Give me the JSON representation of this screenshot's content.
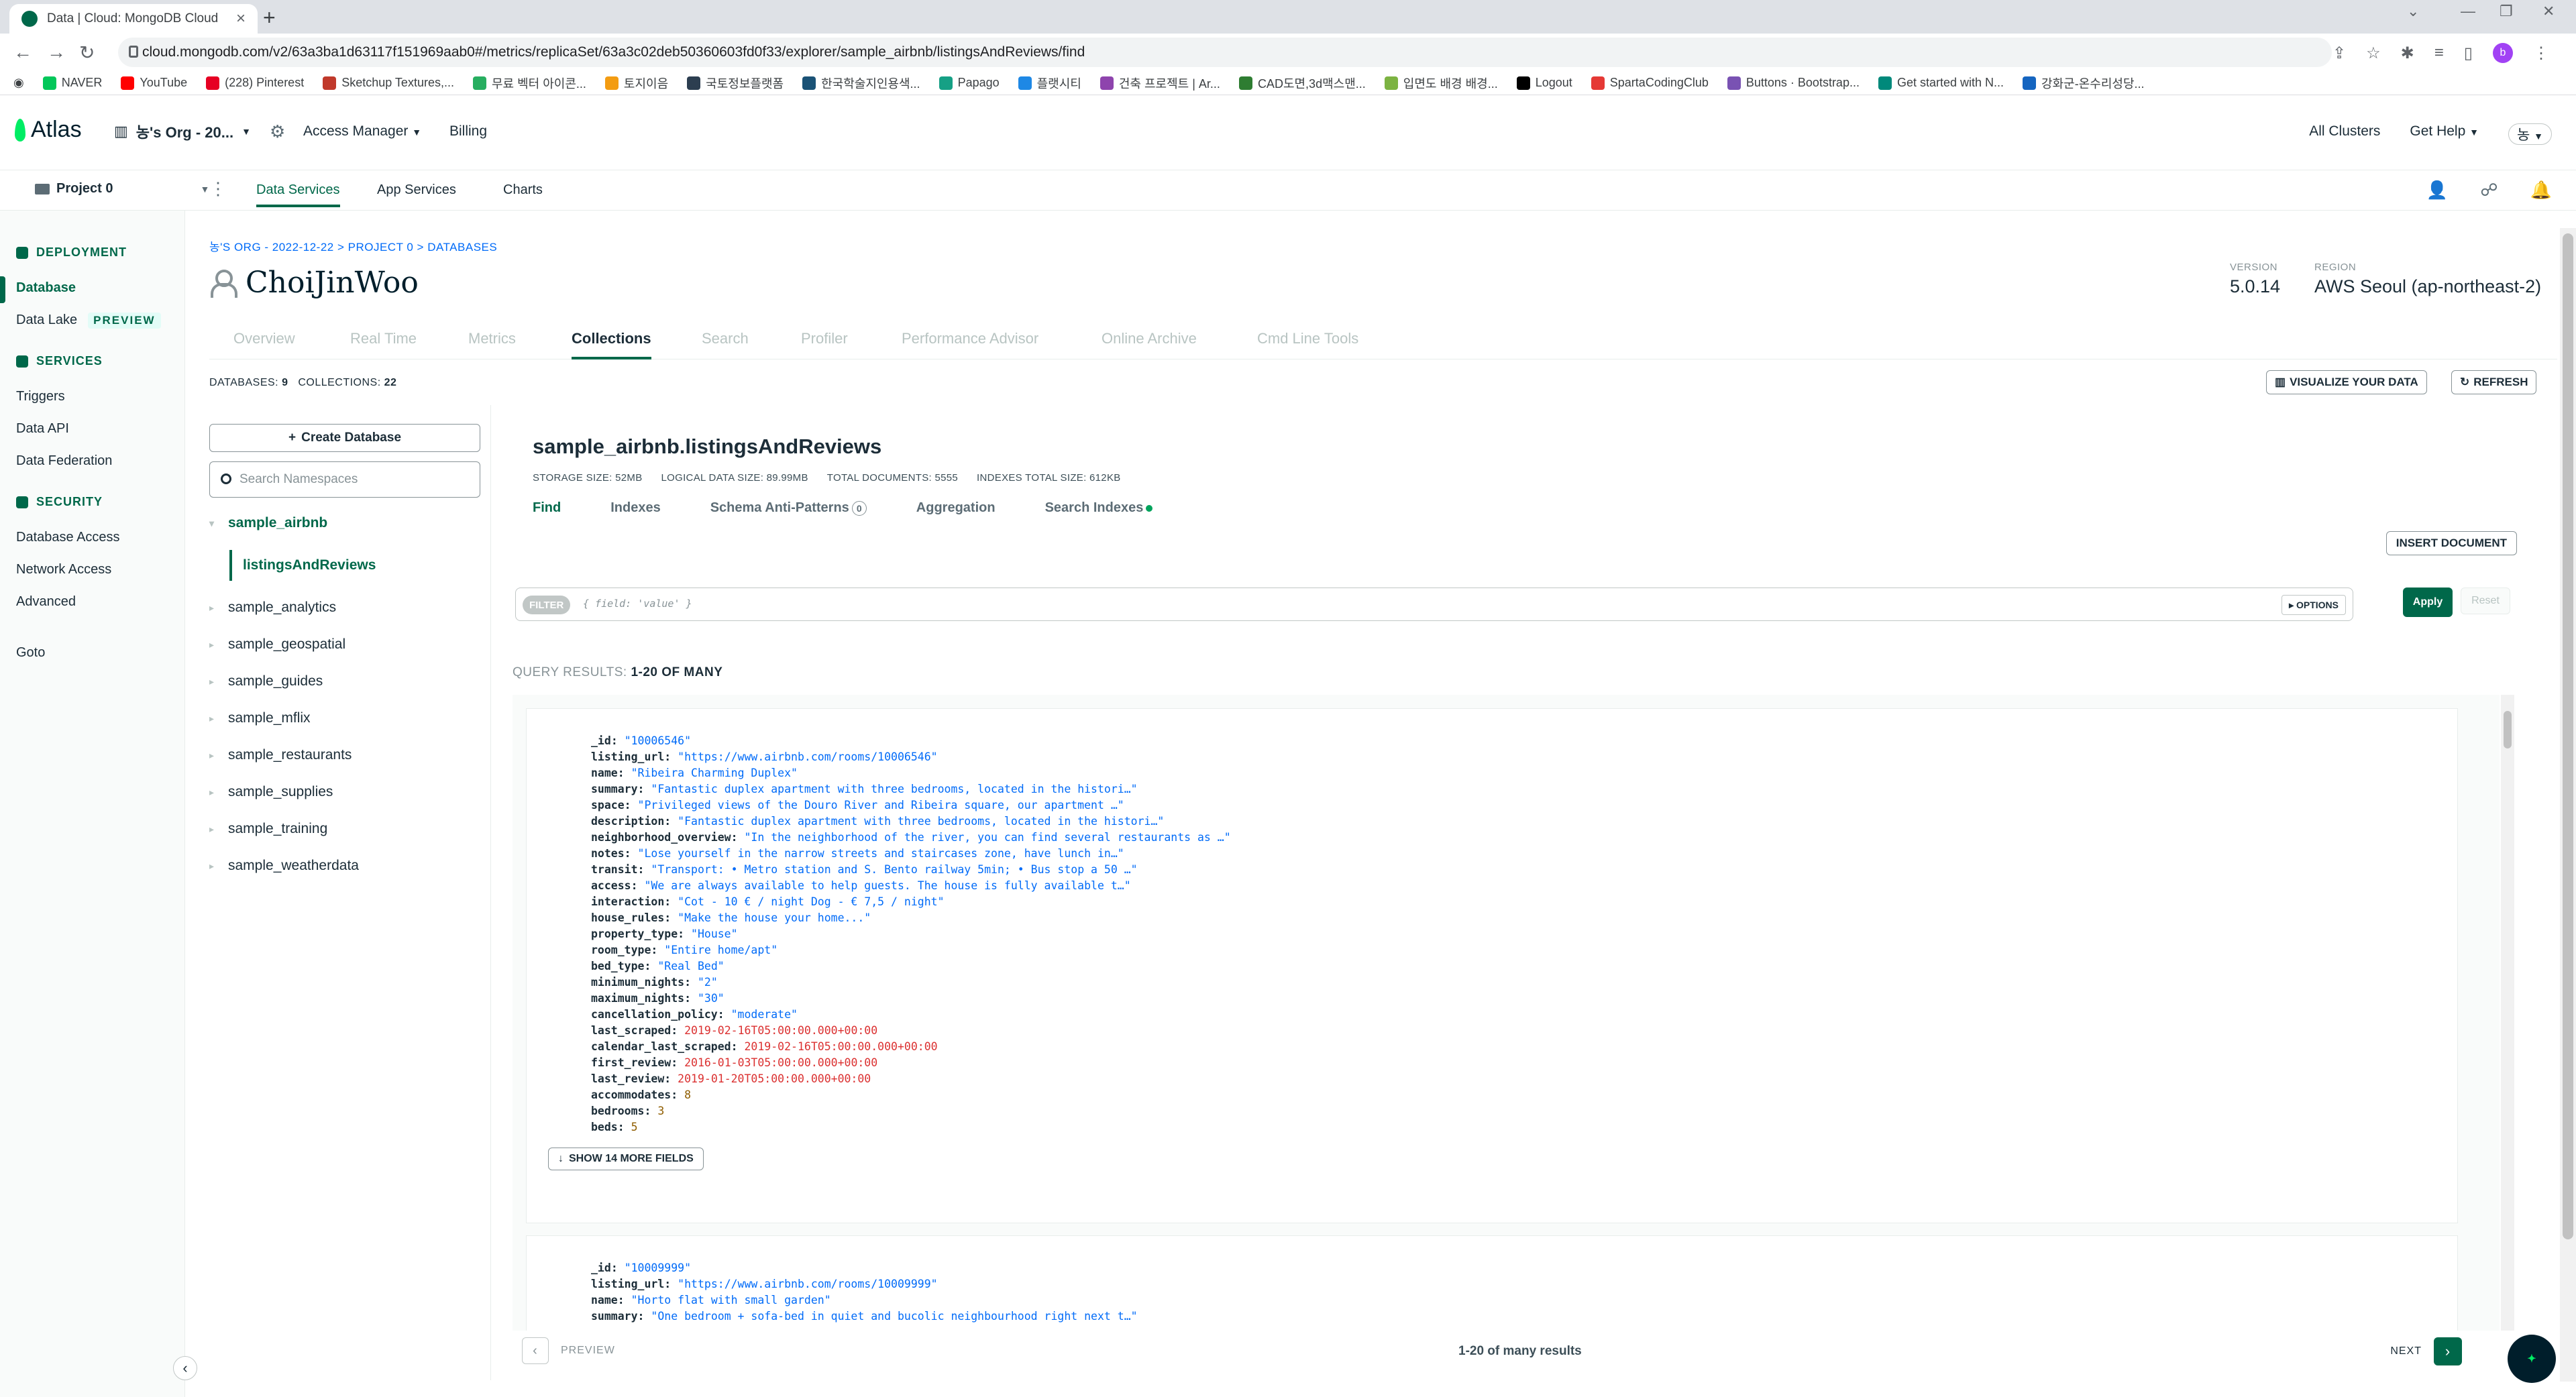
{
  "browser": {
    "tab_title": "Data | Cloud: MongoDB Cloud",
    "url": "cloud.mongodb.com/v2/63a3ba1d63117f151969aab0#/metrics/replicaSet/63a3c02deb50360603fd0f33/explorer/sample_airbnb/listingsAndReviews/find",
    "bookmarks": [
      "NAVER",
      "YouTube",
      "(228) Pinterest",
      "Sketchup Textures,...",
      "무료 벡터 아이콘...",
      "토지이음",
      "국토정보플랫폼",
      "한국학술지인용색...",
      "Papago",
      "플랫시티",
      "건축 프로젝트 | Ar...",
      "CAD도면,3d맥스맨...",
      "입면도 배경 배경...",
      "Logout",
      "SpartaCodingClub",
      "Buttons · Bootstrap...",
      "Get started with N...",
      "강화군-온수리성당..."
    ],
    "bookmark_colors": [
      "#03c75a",
      "#ff0000",
      "#e60023",
      "#c0392b",
      "#27ae60",
      "#f39c12",
      "#2c3e50",
      "#1a5276",
      "#16a085",
      "#1e88e5",
      "#8e44ad",
      "#2e7d32",
      "#7cb342",
      "#000000",
      "#e53935",
      "#7952b3",
      "#00897b",
      "#1565c0"
    ]
  },
  "atlas": {
    "logo": "Atlas",
    "org": "농's Org - 20...",
    "access_manager": "Access Manager",
    "billing": "Billing",
    "all_clusters": "All Clusters",
    "get_help": "Get Help",
    "user_initial": "농",
    "project": "Project 0",
    "subnav": [
      "Data Services",
      "App Services",
      "Charts"
    ]
  },
  "leftnav": {
    "deployment": "DEPLOYMENT",
    "database": "Database",
    "data_lake": "Data Lake",
    "preview": "PREVIEW",
    "services": "SERVICES",
    "triggers": "Triggers",
    "data_api": "Data API",
    "data_federation": "Data Federation",
    "security": "SECURITY",
    "database_access": "Database Access",
    "network_access": "Network Access",
    "advanced": "Advanced",
    "goto": "Goto"
  },
  "cluster": {
    "breadcrumb": "농'S ORG - 2022-12-22 > PROJECT 0 > DATABASES",
    "name": "ChoiJinWoo",
    "version_label": "VERSION",
    "version": "5.0.14",
    "region_label": "REGION",
    "region": "AWS Seoul (ap-northeast-2)",
    "tabs": [
      "Overview",
      "Real Time",
      "Metrics",
      "Collections",
      "Search",
      "Profiler",
      "Performance Advisor",
      "Online Archive",
      "Cmd Line Tools"
    ],
    "databases_label": "DATABASES:",
    "databases_count": "9",
    "collections_label": "COLLECTIONS:",
    "collections_count": "22",
    "visualize": "VISUALIZE YOUR DATA",
    "refresh": "REFRESH"
  },
  "dbpanel": {
    "create_db": "Create Database",
    "search_placeholder": "Search Namespaces",
    "active_db": "sample_airbnb",
    "active_collection": "listingsAndReviews",
    "dbs": [
      "sample_analytics",
      "sample_geospatial",
      "sample_guides",
      "sample_mflix",
      "sample_restaurants",
      "sample_supplies",
      "sample_training",
      "sample_weatherdata"
    ]
  },
  "collection": {
    "title": "sample_airbnb.listingsAndReviews",
    "stats": [
      "STORAGE SIZE: 52MB",
      "LOGICAL DATA SIZE: 89.99MB",
      "TOTAL DOCUMENTS: 5555",
      "INDEXES TOTAL SIZE: 612KB"
    ],
    "tabs": [
      "Find",
      "Indexes",
      "Schema Anti-Patterns",
      "Aggregation",
      "Search Indexes"
    ],
    "anti_patterns_count": "0",
    "insert_document": "INSERT DOCUMENT",
    "filter_chip": "FILTER",
    "filter_placeholder": "{ field: 'value' }",
    "options": "▸ OPTIONS",
    "apply": "Apply",
    "reset": "Reset",
    "query_results_label": "QUERY RESULTS:",
    "query_results_range": "1-20 OF MANY",
    "show_more": "SHOW 14 MORE FIELDS",
    "pager_prev": "PREVIEW",
    "pager_text": "1-20 of many results",
    "pager_next": "NEXT"
  },
  "documents": [
    {
      "fields": [
        {
          "k": "_id",
          "v": "\"10006546\"",
          "t": "s"
        },
        {
          "k": "listing_url",
          "v": "\"https://www.airbnb.com/rooms/10006546\"",
          "t": "s"
        },
        {
          "k": "name",
          "v": "\"Ribeira Charming Duplex\"",
          "t": "s"
        },
        {
          "k": "summary",
          "v": "\"Fantastic duplex apartment with three bedrooms, located in the histori…\"",
          "t": "s"
        },
        {
          "k": "space",
          "v": "\"Privileged views of the Douro River and Ribeira square, our apartment …\"",
          "t": "s"
        },
        {
          "k": "description",
          "v": "\"Fantastic duplex apartment with three bedrooms, located in the histori…\"",
          "t": "s"
        },
        {
          "k": "neighborhood_overview",
          "v": "\"In the neighborhood of the river, you can find several restaurants as …\"",
          "t": "s"
        },
        {
          "k": "notes",
          "v": "\"Lose yourself in the narrow streets and staircases zone, have lunch in…\"",
          "t": "s"
        },
        {
          "k": "transit",
          "v": "\"Transport: • Metro station and S. Bento railway 5min; • Bus stop a 50 …\"",
          "t": "s"
        },
        {
          "k": "access",
          "v": "\"We are always available to help guests. The house is fully available t…\"",
          "t": "s"
        },
        {
          "k": "interaction",
          "v": "\"Cot - 10 € / night Dog - € 7,5 / night\"",
          "t": "s"
        },
        {
          "k": "house_rules",
          "v": "\"Make the house your home...\"",
          "t": "s"
        },
        {
          "k": "property_type",
          "v": "\"House\"",
          "t": "s"
        },
        {
          "k": "room_type",
          "v": "\"Entire home/apt\"",
          "t": "s"
        },
        {
          "k": "bed_type",
          "v": "\"Real Bed\"",
          "t": "s"
        },
        {
          "k": "minimum_nights",
          "v": "\"2\"",
          "t": "s"
        },
        {
          "k": "maximum_nights",
          "v": "\"30\"",
          "t": "s"
        },
        {
          "k": "cancellation_policy",
          "v": "\"moderate\"",
          "t": "s"
        },
        {
          "k": "last_scraped",
          "v": "2019-02-16T05:00:00.000+00:00",
          "t": "d"
        },
        {
          "k": "calendar_last_scraped",
          "v": "2019-02-16T05:00:00.000+00:00",
          "t": "d"
        },
        {
          "k": "first_review",
          "v": "2016-01-03T05:00:00.000+00:00",
          "t": "d"
        },
        {
          "k": "last_review",
          "v": "2019-01-20T05:00:00.000+00:00",
          "t": "d"
        },
        {
          "k": "accommodates",
          "v": "8",
          "t": "n"
        },
        {
          "k": "bedrooms",
          "v": "3",
          "t": "n"
        },
        {
          "k": "beds",
          "v": "5",
          "t": "n"
        }
      ]
    },
    {
      "fields": [
        {
          "k": "_id",
          "v": "\"10009999\"",
          "t": "s"
        },
        {
          "k": "listing_url",
          "v": "\"https://www.airbnb.com/rooms/10009999\"",
          "t": "s"
        },
        {
          "k": "name",
          "v": "\"Horto flat with small garden\"",
          "t": "s"
        },
        {
          "k": "summary",
          "v": "\"One bedroom + sofa-bed in quiet and bucolic neighbourhood right next t…\"",
          "t": "s"
        }
      ]
    }
  ]
}
